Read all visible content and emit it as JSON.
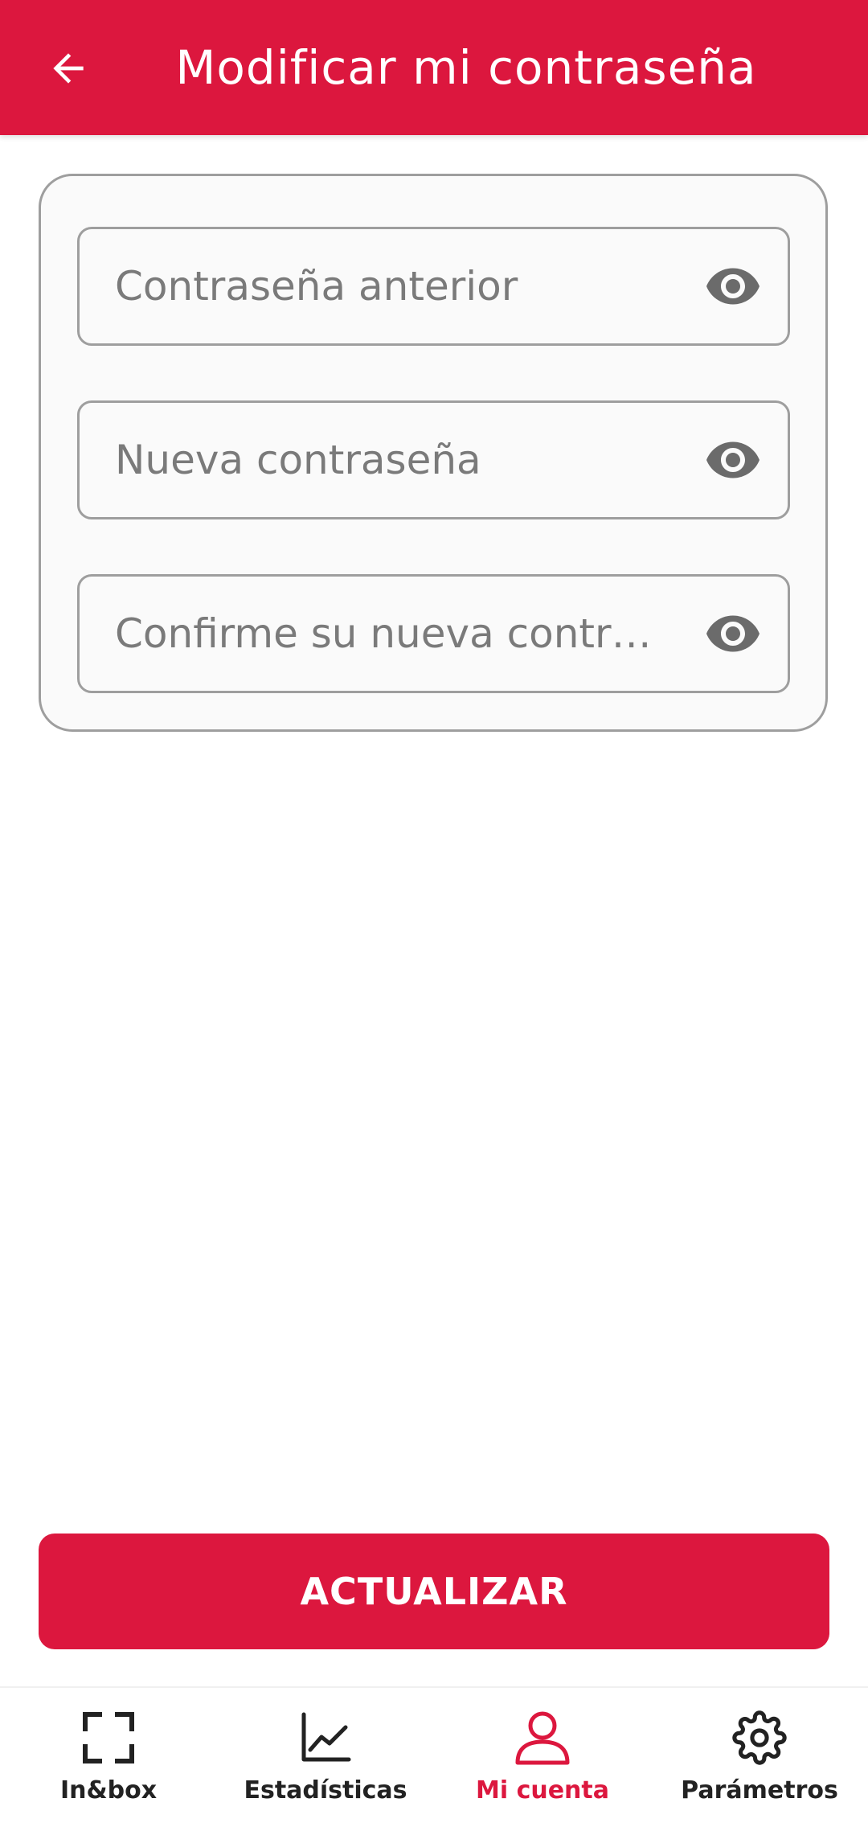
{
  "header": {
    "title": "Modificar mi contraseña",
    "back_icon": "arrow-left-icon"
  },
  "form": {
    "fields": [
      {
        "placeholder": "Contraseña anterior",
        "value": "",
        "icon": "eye-icon"
      },
      {
        "placeholder": "Nueva contraseña",
        "value": "",
        "icon": "eye-icon"
      },
      {
        "placeholder": "Confirme su nueva contraseña",
        "value": "",
        "icon": "eye-icon"
      }
    ]
  },
  "actions": {
    "update_label": "ACTUALIZAR"
  },
  "bottom_nav": {
    "items": [
      {
        "label": "In&box",
        "icon": "scan-frame-icon",
        "active": false
      },
      {
        "label": "Estadísticas",
        "icon": "line-chart-icon",
        "active": false
      },
      {
        "label": "Mi cuenta",
        "icon": "user-icon",
        "active": true
      },
      {
        "label": "Parámetros",
        "icon": "gear-icon",
        "active": false
      }
    ]
  },
  "colors": {
    "primary": "#dc173e",
    "border": "#9e9e9e",
    "placeholder": "#7a7a7a",
    "icon_gray": "#6b6b6b"
  }
}
